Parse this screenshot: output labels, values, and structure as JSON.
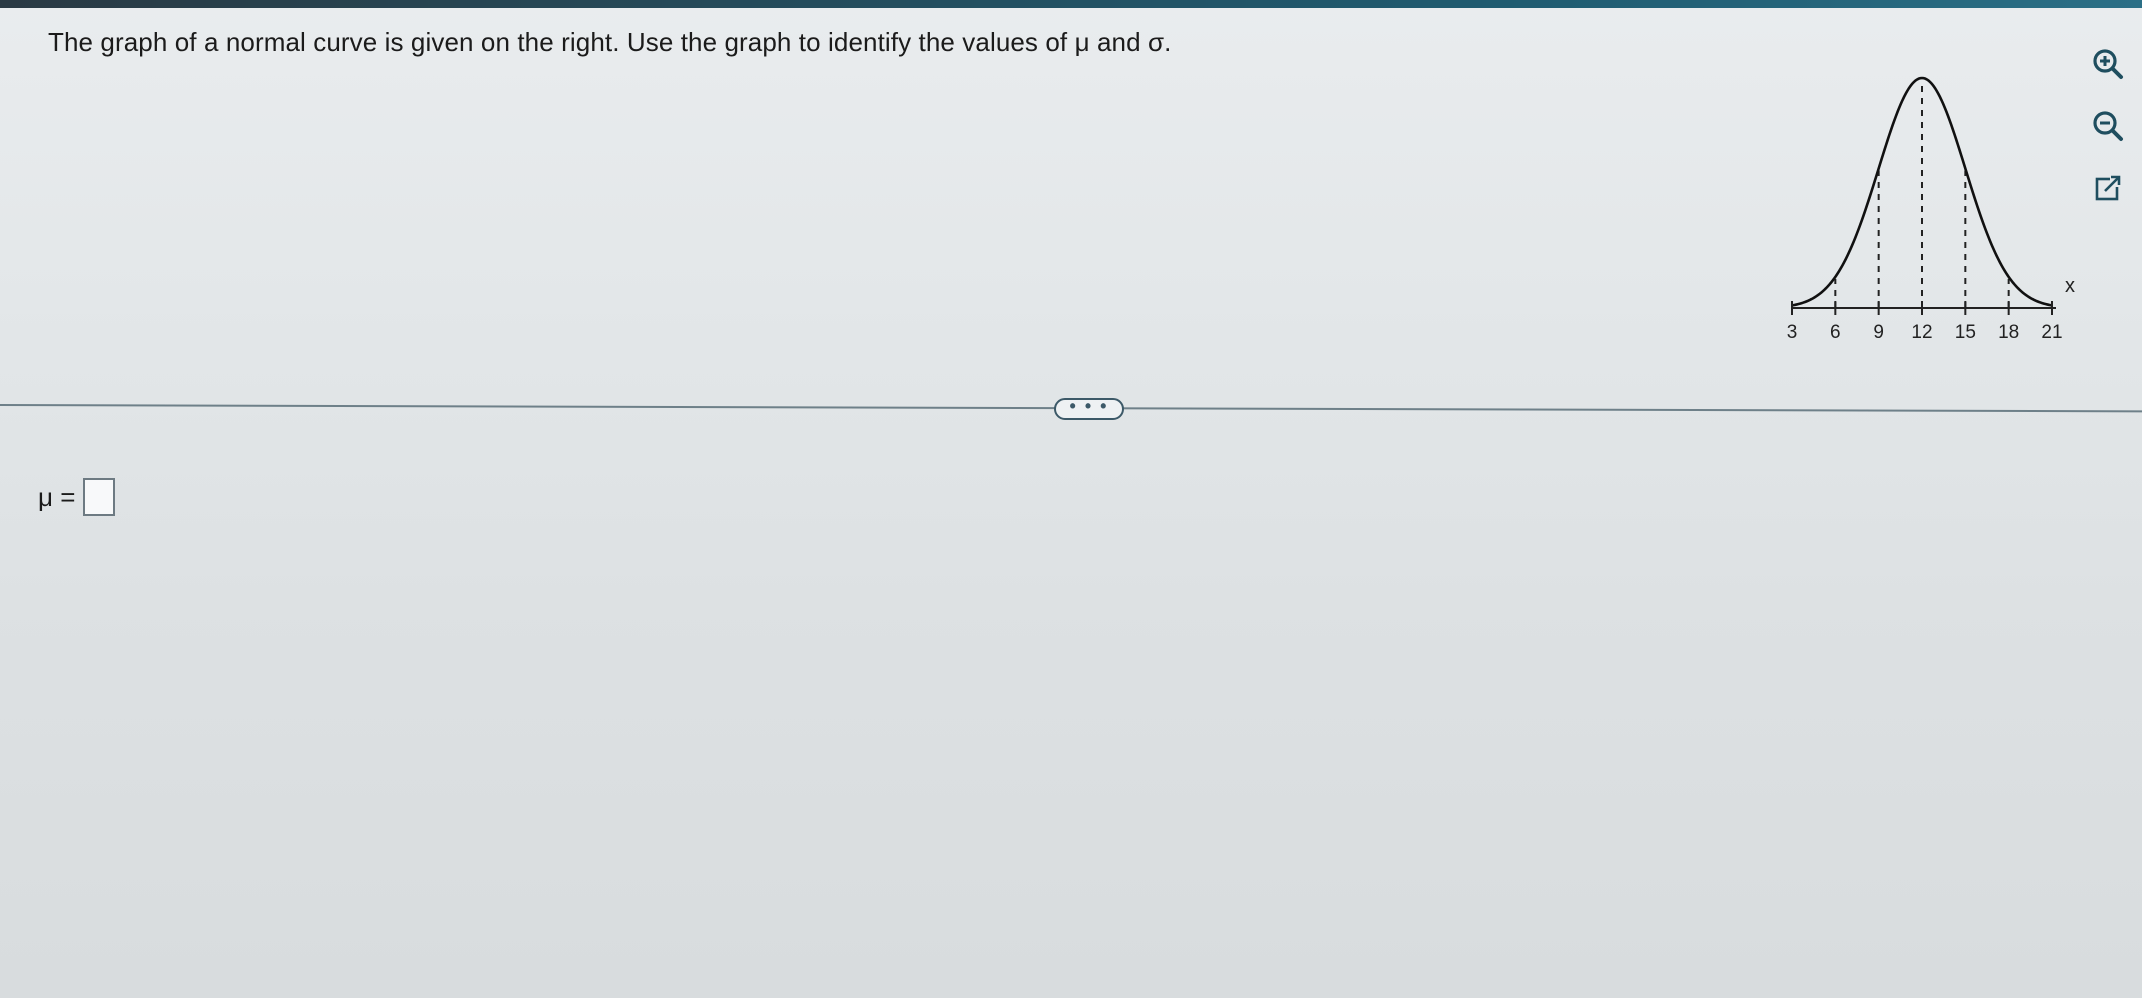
{
  "question": {
    "text": "The graph of a normal curve is given on the right. Use the graph to identify the values of μ and σ."
  },
  "chart_data": {
    "type": "line",
    "curve": "normal",
    "mean": 12,
    "std_dev": 3,
    "x_axis_label": "x",
    "x_ticks": [
      3,
      6,
      9,
      12,
      15,
      18,
      21
    ],
    "tick_labels": [
      "3",
      "6",
      "9",
      "12",
      "15",
      "18",
      "21"
    ],
    "dashed_lines_at": [
      6,
      9,
      12,
      15,
      18
    ],
    "xlim": [
      3,
      21
    ],
    "grid": false,
    "legend": false
  },
  "tools": {
    "icons": [
      "zoom-in-icon",
      "zoom-out-icon",
      "popout-icon"
    ],
    "accent_color": "#1f4e5f"
  },
  "divider": {
    "more_label": "• • •"
  },
  "answer": {
    "label": "μ =",
    "value": ""
  }
}
